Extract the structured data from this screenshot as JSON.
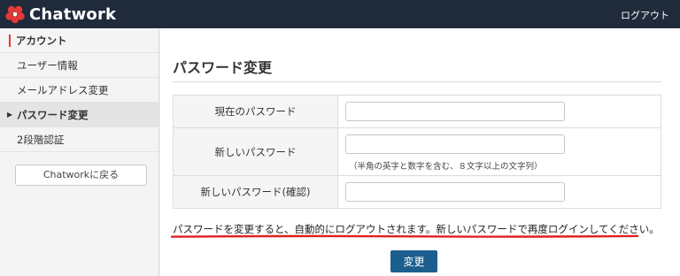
{
  "app": {
    "name": "Chatwork"
  },
  "header": {
    "logout_label": "ログアウト"
  },
  "sidebar": {
    "section_title": "アカウント",
    "items": [
      {
        "label": "ユーザー情報",
        "active": false
      },
      {
        "label": "メールアドレス変更",
        "active": false
      },
      {
        "label": "パスワード変更",
        "active": true
      },
      {
        "label": "2段階認証",
        "active": false
      }
    ],
    "back_button": "Chatworkに戻る"
  },
  "main": {
    "title": "パスワード変更",
    "fields": [
      {
        "label": "現在のパスワード",
        "value": ""
      },
      {
        "label": "新しいパスワード",
        "value": "",
        "hint": "（半角の英字と数字を含む、８文字以上の文字列）"
      },
      {
        "label": "新しいパスワード(確認)",
        "value": ""
      }
    ],
    "notice": "パスワードを変更すると、自動的にログアウトされます。新しいパスワードで再度ログインしてください。",
    "submit_label": "変更"
  },
  "colors": {
    "header_bg": "#1f2a3a",
    "logo_accent": "#e53935",
    "button_primary": "#1c5f8f",
    "underline_annotation": "#e02020"
  }
}
